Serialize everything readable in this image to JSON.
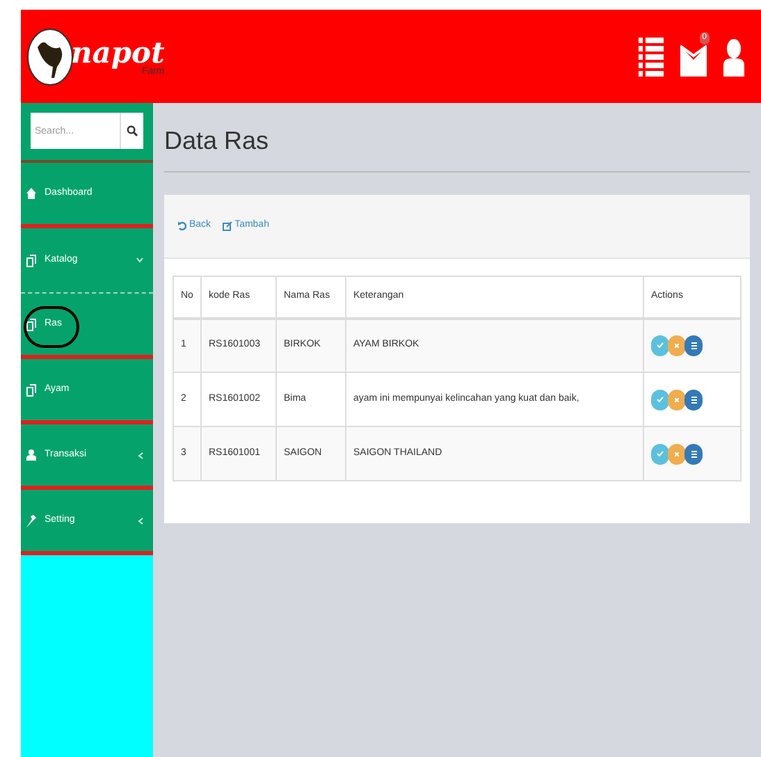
{
  "header": {
    "logo": {
      "name": "napot",
      "sub": "Farm"
    },
    "mail_badge": "0"
  },
  "sidebar": {
    "search": {
      "placeholder": "Search..."
    },
    "items": [
      {
        "label": "Dashboard",
        "kind": "home"
      },
      {
        "label": "Katalog",
        "kind": "catalog",
        "expanded": true,
        "children": [
          {
            "label": "Ras",
            "kind": "catalog",
            "circled": true
          },
          {
            "label": "Ayam",
            "kind": "catalog",
            "circled": false
          }
        ]
      },
      {
        "label": "Transaksi",
        "kind": "user",
        "expanded": false
      },
      {
        "label": "Setting",
        "kind": "wrench",
        "expanded": false
      }
    ]
  },
  "page": {
    "title": "Data Ras",
    "toolbar": [
      "Back",
      "Tambah"
    ],
    "table": {
      "columns": [
        "No",
        "kode Ras",
        "Nama Ras",
        "Keterangan",
        "Actions"
      ],
      "rows": [
        [
          "1",
          "RS1601003",
          "BIRKOK",
          "AYAM BIRKOK"
        ],
        [
          "2",
          "RS1601002",
          "Bima",
          "ayam ini mempunyai kelincahan yang kuat dan baik,"
        ],
        [
          "3",
          "RS1601001",
          "SAIGON",
          "SAIGON THAILAND"
        ]
      ]
    }
  }
}
